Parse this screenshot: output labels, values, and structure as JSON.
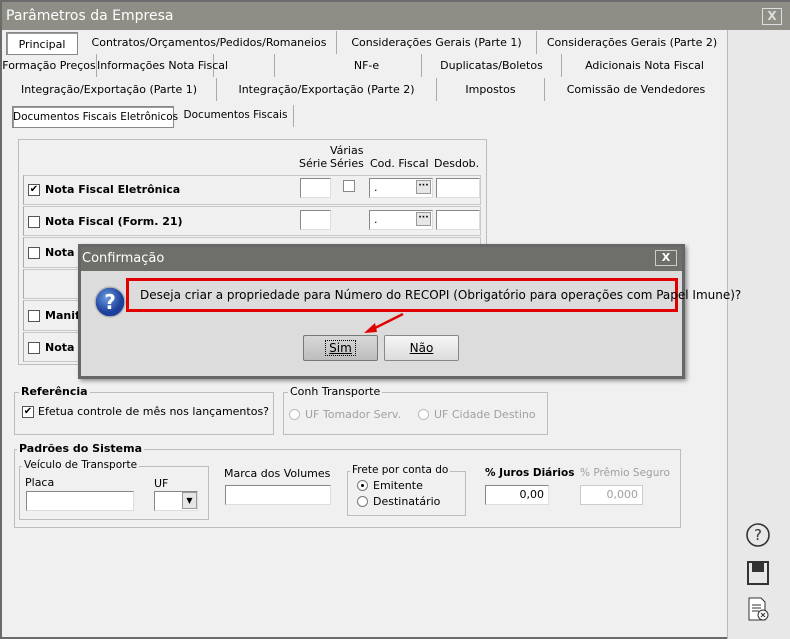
{
  "window": {
    "title": "Parâmetros da Empresa",
    "close": "X"
  },
  "tabs": {
    "row1": [
      "Principal",
      "Contratos/Orçamentos/Pedidos/Romaneios",
      "Considerações Gerais (Parte 1)",
      "Considerações Gerais (Parte 2)"
    ],
    "row2": [
      "Formação Preços",
      "Informações Nota Fiscal",
      "NF-e",
      "Duplicatas/Boletos",
      "Adicionais Nota Fiscal"
    ],
    "row3": [
      "Integração/Exportação (Parte 1)",
      "Integração/Exportação (Parte 2)",
      "Impostos",
      "Comissão de Vendedores"
    ],
    "active": "Principal"
  },
  "subtabs": {
    "items": [
      "Documentos Fiscais Eletrônicos",
      "Documentos Fiscais"
    ],
    "active": "Documentos Fiscais Eletrônicos"
  },
  "docs_table": {
    "headers": {
      "serie": "Série",
      "varias_series": "Várias Séries",
      "varias1": "Várias",
      "varias2": "Séries",
      "cod_fiscal": "Cod. Fiscal",
      "desdob": "Desdob."
    },
    "rows": [
      {
        "label": "Nota Fiscal Eletrônica",
        "checked": true,
        "cod_fiscal": "."
      },
      {
        "label": "Nota Fiscal (Form. 21)",
        "checked": false,
        "cod_fiscal": "."
      },
      {
        "label": "Nota c",
        "checked": false
      },
      {
        "label": "Manif",
        "checked": false
      },
      {
        "label": "Nota F",
        "checked": false
      }
    ]
  },
  "referencia": {
    "title": "Referência",
    "checkbox_label": "Efetua controle de mês nos lançamentos?",
    "checked": true
  },
  "conh_transporte": {
    "title": "Conh Transporte",
    "options": [
      "UF Tomador Serv.",
      "UF Cidade Destino"
    ]
  },
  "padroes": {
    "title": "Padrões do Sistema",
    "veiculo": {
      "title": "Veículo de Transporte",
      "placa_label": "Placa",
      "placa_value": "",
      "uf_label": "UF",
      "uf_value": ""
    },
    "marca_label": "Marca dos Volumes",
    "marca_value": "",
    "frete": {
      "title": "Frete por conta do",
      "options": [
        "Emitente",
        "Destinatário"
      ],
      "selected": "Emitente"
    },
    "juros_label": "% Juros Diários",
    "juros_value": "0,00",
    "premio_label": "% Prêmio Seguro",
    "premio_value": "0,000"
  },
  "side_icons": [
    "help-icon",
    "save-icon",
    "cancel-document-icon"
  ],
  "dialog": {
    "title": "Confirmação",
    "message": "Deseja criar a propriedade para Número do RECOPI (Obrigatório para operações com Papel Imune)?",
    "yes": "Sim",
    "no": "Não",
    "close": "X",
    "highlight_color": "#e00000"
  }
}
